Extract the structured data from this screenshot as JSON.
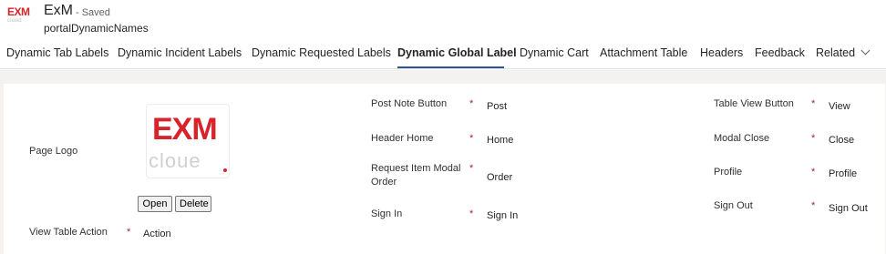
{
  "app": {
    "logo_text": "EXM",
    "logo_subtext": "cloud",
    "title": "ExM",
    "status": "- Saved",
    "subtitle": "portalDynamicNames"
  },
  "tabs": [
    {
      "label": "Dynamic Tab Labels",
      "active": false
    },
    {
      "label": "Dynamic Incident Labels",
      "active": false
    },
    {
      "label": "Dynamic Requested Labels",
      "active": false
    },
    {
      "label": "Dynamic Global Label",
      "active": true
    },
    {
      "label": "Dynamic Cart",
      "active": false
    },
    {
      "label": "Attachment Table",
      "active": false
    },
    {
      "label": "Headers",
      "active": false
    },
    {
      "label": "Feedback",
      "active": false
    },
    {
      "label": "Related",
      "active": false
    }
  ],
  "colors": {
    "brand_red": "#d8232a",
    "accent_blue": "#2b579a",
    "required_red": "#a4262c"
  },
  "form": {
    "required_marker": "*",
    "page_logo": {
      "label": "Page Logo",
      "logo_text": "EXM",
      "logo_subtext": "cloue",
      "open_label": "Open",
      "delete_label": "Delete"
    },
    "view_table_action": {
      "label": "View Table Action",
      "value": "Action"
    },
    "post_note_button": {
      "label": "Post Note Button",
      "value": "Post"
    },
    "header_home": {
      "label": "Header Home",
      "value": "Home"
    },
    "request_item_modal_order": {
      "label_line1": "Request Item Modal",
      "label_line2": "Order",
      "value": "Order"
    },
    "sign_in": {
      "label": "Sign In",
      "value": "Sign In"
    },
    "table_view_button": {
      "label": "Table View Button",
      "value": "View"
    },
    "modal_close": {
      "label": "Modal Close",
      "value": "Close"
    },
    "profile": {
      "label": "Profile",
      "value": "Profile"
    },
    "sign_out": {
      "label": "Sign Out",
      "value": "Sign Out"
    }
  }
}
